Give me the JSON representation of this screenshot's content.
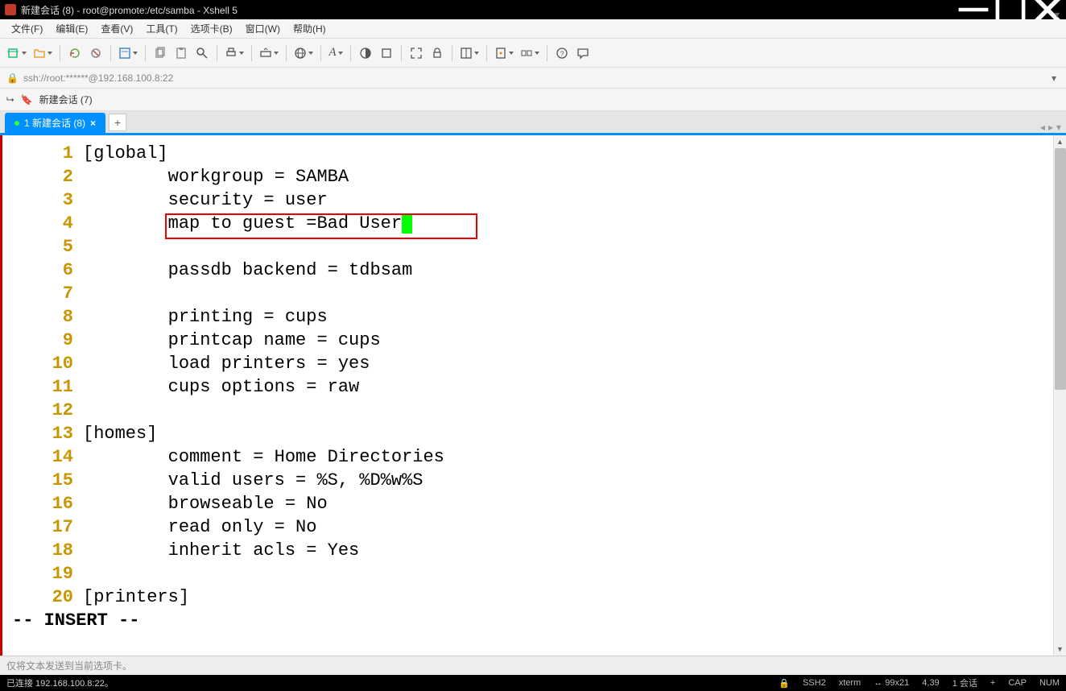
{
  "window": {
    "title": "新建会话 (8) - root@promote:/etc/samba - Xshell 5"
  },
  "menus": [
    "文件(F)",
    "编辑(E)",
    "查看(V)",
    "工具(T)",
    "选项卡(B)",
    "窗口(W)",
    "帮助(H)"
  ],
  "address": "ssh://root:******@192.168.100.8:22",
  "session_nav": "新建会话 (7)",
  "tab": {
    "label": "1 新建会话 (8)"
  },
  "editor": {
    "lines": [
      {
        "n": "1",
        "t": "[global]"
      },
      {
        "n": "2",
        "t": "        workgroup = SAMBA"
      },
      {
        "n": "3",
        "t": "        security = user"
      },
      {
        "n": "4",
        "t": "        map to guest =Bad User"
      },
      {
        "n": "5",
        "t": ""
      },
      {
        "n": "6",
        "t": "        passdb backend = tdbsam"
      },
      {
        "n": "7",
        "t": ""
      },
      {
        "n": "8",
        "t": "        printing = cups"
      },
      {
        "n": "9",
        "t": "        printcap name = cups"
      },
      {
        "n": "10",
        "t": "        load printers = yes"
      },
      {
        "n": "11",
        "t": "        cups options = raw"
      },
      {
        "n": "12",
        "t": ""
      },
      {
        "n": "13",
        "t": "[homes]"
      },
      {
        "n": "14",
        "t": "        comment = Home Directories"
      },
      {
        "n": "15",
        "t": "        valid users = %S, %D%w%S"
      },
      {
        "n": "16",
        "t": "        browseable = No"
      },
      {
        "n": "17",
        "t": "        read only = No"
      },
      {
        "n": "18",
        "t": "        inherit acls = Yes"
      },
      {
        "n": "19",
        "t": ""
      },
      {
        "n": "20",
        "t": "[printers]"
      }
    ],
    "mode": "-- INSERT --",
    "cursor_line_index": 3
  },
  "notice": "仅将文本发送到当前选项卡。",
  "status": {
    "connection": "已连接 192.168.100.8:22。",
    "proto": "SSH2",
    "term": "xterm",
    "size": "99x21",
    "pos": "4,39",
    "sessions": "1 会话",
    "cap": "CAP",
    "num": "NUM"
  }
}
